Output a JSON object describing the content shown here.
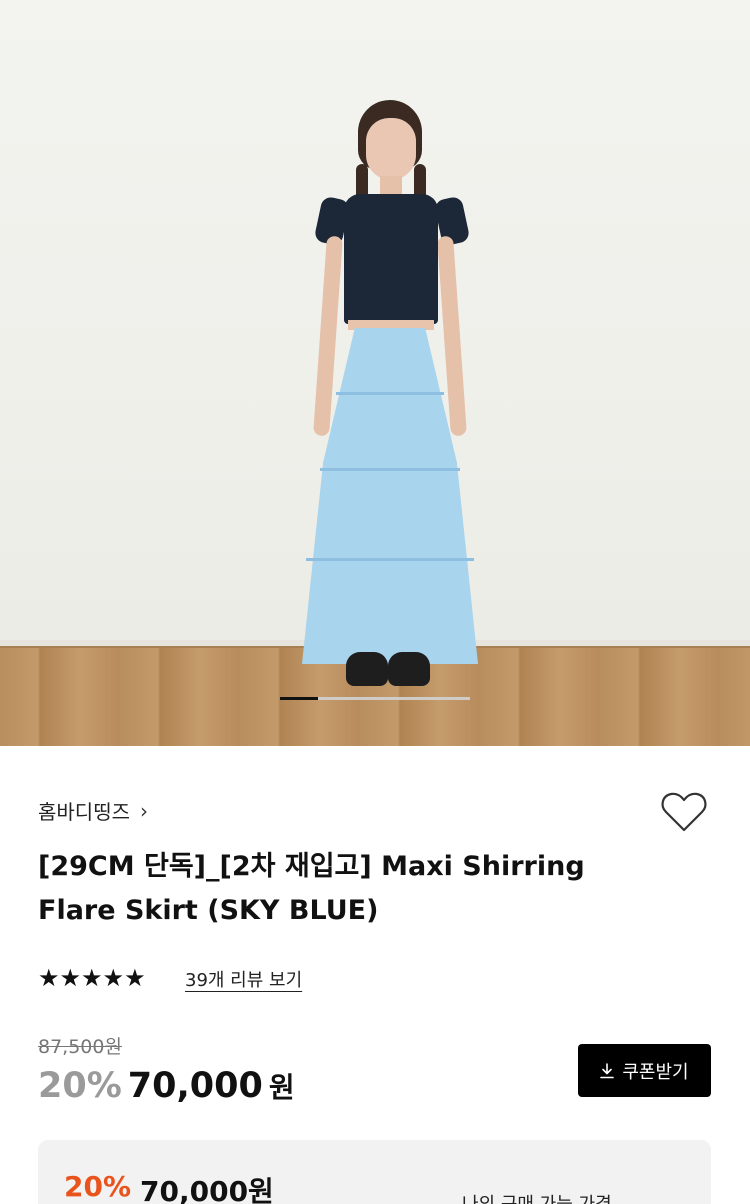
{
  "product_image": {
    "slide_current": 1,
    "slide_total": 5,
    "progress_fraction": 0.2
  },
  "brand": {
    "name": "홈바디띵즈",
    "chevron": "›"
  },
  "product": {
    "title": "[29CM 단독]_[2차 재입고] Maxi Shirring Flare Skirt (SKY BLUE)"
  },
  "rating": {
    "stars": "★★★★★",
    "star_count": 5,
    "review_link": "39개 리뷰 보기"
  },
  "price": {
    "original": "87,500원",
    "discount_rate": "20%",
    "sale_amount": "70,000",
    "sale_unit": "원",
    "coupon_button": "쿠폰받기"
  },
  "my_price": {
    "discount_rate": "20%",
    "amount": "70,000원",
    "label": "나의 구매 가능 가격"
  },
  "colors": {
    "accent_orange": "#e8541c",
    "button_black": "#000000",
    "muted_gray": "#9a9a9a"
  },
  "icons": {
    "heart": "heart-icon",
    "download": "download-icon",
    "chevron": "chevron-right-icon",
    "star": "star-icon"
  }
}
